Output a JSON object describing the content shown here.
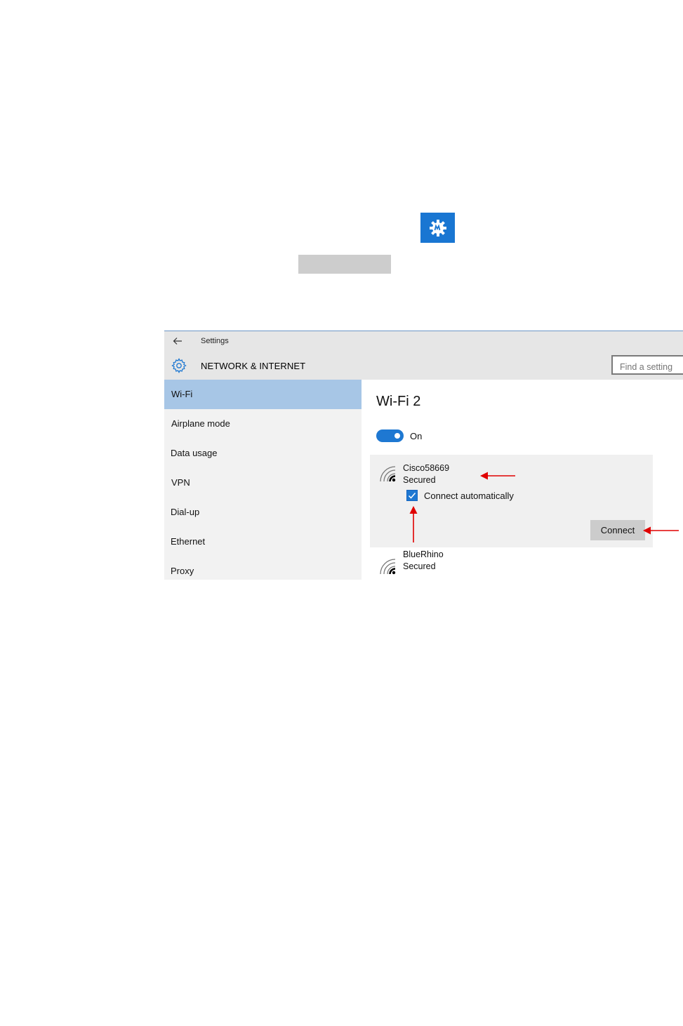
{
  "window": {
    "title": "Settings",
    "section_title": "NETWORK & INTERNET",
    "search": {
      "placeholder": "Find a setting"
    }
  },
  "sidebar": {
    "items": [
      {
        "label": "Wi-Fi",
        "active": true
      },
      {
        "label": "Airplane mode",
        "active": false
      },
      {
        "label": "Data usage",
        "active": false
      },
      {
        "label": "VPN",
        "active": false
      },
      {
        "label": "Dial-up",
        "active": false
      },
      {
        "label": "Ethernet",
        "active": false
      },
      {
        "label": "Proxy",
        "active": false
      }
    ]
  },
  "main": {
    "heading": "Wi-Fi 2",
    "toggle": {
      "label": "On",
      "state": true
    },
    "networks": [
      {
        "name": "Cisco58669",
        "status": "Secured",
        "connect_automatically": {
          "label": "Connect automatically",
          "checked": true
        },
        "connect_button": "Connect"
      },
      {
        "name": "BlueRhino",
        "status": "Secured"
      }
    ]
  },
  "colors": {
    "accent": "#1e78d2",
    "nav_active": "#a7c6e6",
    "app_tile": "#1976d2",
    "annotation_arrow": "#e00000"
  },
  "icons": {
    "app_tile": "settings-gear-icon",
    "back": "back-arrow-icon",
    "header": "gear-icon",
    "network": "wifi-signal-icon",
    "checkbox": "checkmark-icon"
  }
}
